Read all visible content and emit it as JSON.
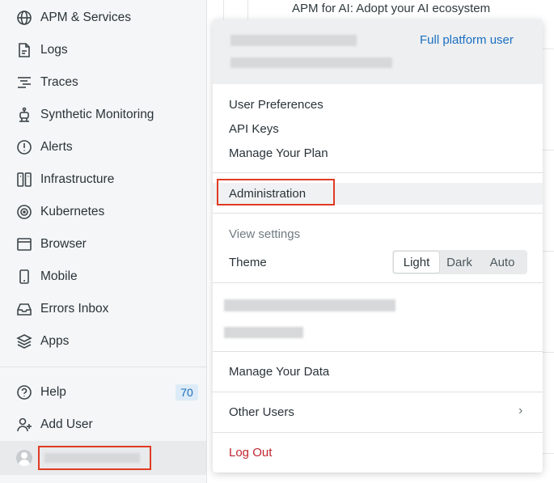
{
  "sidebar": {
    "items": [
      {
        "label": "APM & Services",
        "icon": "globe-icon"
      },
      {
        "label": "Logs",
        "icon": "document-icon"
      },
      {
        "label": "Traces",
        "icon": "traces-icon"
      },
      {
        "label": "Synthetic Monitoring",
        "icon": "robot-icon"
      },
      {
        "label": "Alerts",
        "icon": "alert-icon"
      },
      {
        "label": "Infrastructure",
        "icon": "infrastructure-icon"
      },
      {
        "label": "Kubernetes",
        "icon": "kubernetes-icon"
      },
      {
        "label": "Browser",
        "icon": "browser-icon"
      },
      {
        "label": "Mobile",
        "icon": "mobile-icon"
      },
      {
        "label": "Errors Inbox",
        "icon": "inbox-icon"
      },
      {
        "label": "Apps",
        "icon": "layers-icon"
      }
    ],
    "help": {
      "label": "Help",
      "badge": "70",
      "icon": "help-icon"
    },
    "add_user": {
      "label": "Add User",
      "icon": "add-user-icon"
    }
  },
  "background": {
    "headline": "APM for AI: Adopt your AI ecosystem"
  },
  "menu": {
    "user_type": "Full platform user",
    "items_group1": [
      "User Preferences",
      "API Keys",
      "Manage Your Plan"
    ],
    "administration": "Administration",
    "view_settings": "View settings",
    "theme_label": "Theme",
    "theme_options": [
      "Light",
      "Dark",
      "Auto"
    ],
    "theme_selected": "Light",
    "manage_data": "Manage Your Data",
    "other_users": "Other Users",
    "log_out": "Log Out"
  },
  "colors": {
    "accent_blue": "#1a6fc2",
    "highlight_red": "#e03b24",
    "logout_red": "#c1262f"
  }
}
